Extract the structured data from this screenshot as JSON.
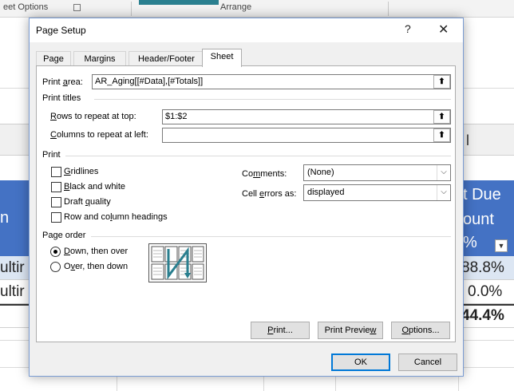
{
  "background": {
    "ribbon_group_1": "eet Options",
    "ribbon_group_2": "Arrange",
    "column_header_mark": "l",
    "header_text_left": "n",
    "header_text_right_1": "t Due",
    "header_text_right_2": "ount",
    "header_text_right_3": "%",
    "row1_left": "ultir",
    "row1_right": "88.8%",
    "row2_left": "ultir",
    "row2_right": "0.0%",
    "row3_right": "44.4%",
    "filter_glyph": "▼"
  },
  "dialog": {
    "title": "Page Setup",
    "help_glyph": "?",
    "close_glyph": "✕",
    "tabs": [
      {
        "label": "Page"
      },
      {
        "label": "Margins"
      },
      {
        "label": "Header/Footer"
      },
      {
        "label": "Sheet"
      }
    ],
    "print_area": {
      "label_pre": "Print ",
      "label_u": "a",
      "label_post": "rea:",
      "value": "AR_Aging[[#Data],[#Totals]]"
    },
    "print_titles": {
      "section": "Print titles",
      "rows_label_u": "R",
      "rows_label_post": "ows to repeat at top:",
      "rows_value": "$1:$2",
      "cols_label_u": "C",
      "cols_label_post": "olumns to repeat at left:",
      "cols_value": ""
    },
    "print": {
      "section": "Print",
      "gridlines_u": "G",
      "gridlines_post": "ridlines",
      "bw_pre": "",
      "bw_u": "B",
      "bw_post": "lack and white",
      "draft_pre": "Draft ",
      "draft_u": "q",
      "draft_post": "uality",
      "rowcol_pre": "Row and co",
      "rowcol_u": "l",
      "rowcol_post": "umn headings",
      "comments_pre": "Co",
      "comments_u": "m",
      "comments_post": "ments:",
      "comments_value": "(None)",
      "errors_pre": "Cell ",
      "errors_u": "e",
      "errors_post": "rrors as:",
      "errors_value": "displayed",
      "collapse_glyph": "⬆",
      "dropdown_glyph": "⌵"
    },
    "page_order": {
      "section": "Page order",
      "down_u": "D",
      "down_post": "own, then over",
      "over_pre": "O",
      "over_u": "v",
      "over_post": "er, then down"
    },
    "buttons": {
      "print_u": "P",
      "print_post": "rint...",
      "preview_pre": "Print Previe",
      "preview_u": "w",
      "options_u": "O",
      "options_post": "ptions...",
      "ok": "OK",
      "cancel": "Cancel"
    },
    "colors": {
      "accent": "#0078d7",
      "table_header": "#4472c4",
      "preview_arrow": "#2a7f8f"
    }
  }
}
